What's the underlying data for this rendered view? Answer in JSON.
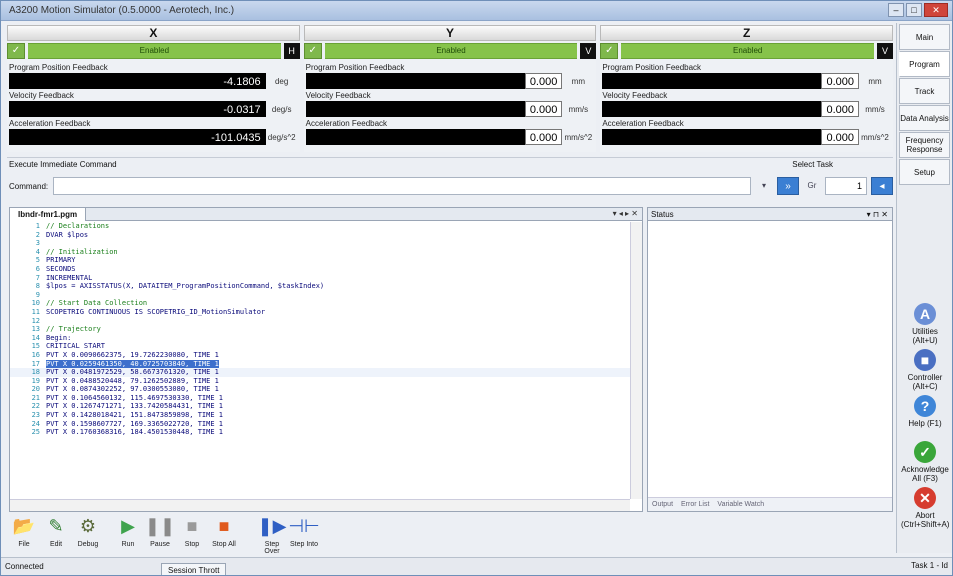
{
  "window": {
    "title": "A3200 Motion Simulator (0.5.0000 - Aerotech, Inc.)"
  },
  "axes": [
    {
      "name": "X",
      "state": "Enabled",
      "unit_btn": "H",
      "pos_label": "Program Position Feedback",
      "pos_val": "-4.1806",
      "pos_unit": "deg",
      "vel_label": "Velocity Feedback",
      "vel_val": "-0.0317",
      "vel_unit": "deg/s",
      "acc_label": "Acceleration Feedback",
      "acc_val": "-101.0435",
      "acc_unit": "deg/s^2"
    },
    {
      "name": "Y",
      "state": "Enabled",
      "unit_btn": "V",
      "pos_label": "Program Position Feedback",
      "pos_val": "0.000",
      "pos_unit": "mm",
      "vel_label": "Velocity Feedback",
      "vel_val": "0.000",
      "vel_unit": "mm/s",
      "acc_label": "Acceleration Feedback",
      "acc_val": "0.000",
      "acc_unit": "mm/s^2"
    },
    {
      "name": "Z",
      "state": "Enabled",
      "unit_btn": "V",
      "pos_label": "Program Position Feedback",
      "pos_val": "0.000",
      "pos_unit": "mm",
      "vel_label": "Velocity Feedback",
      "vel_val": "0.000",
      "vel_unit": "mm/s",
      "acc_label": "Acceleration Feedback",
      "acc_val": "0.000",
      "acc_unit": "mm/s^2"
    }
  ],
  "side_tabs": [
    "Main",
    "Program",
    "Track",
    "Data Analysis",
    "Frequency Response",
    "Setup"
  ],
  "side_icons": [
    {
      "label": "Utilities (Alt+U)",
      "glyph": "A"
    },
    {
      "label": "Controller (Alt+C)",
      "glyph": "■"
    },
    {
      "label": "Help (F1)",
      "glyph": "?"
    },
    {
      "label": "Acknowledge All (F3)",
      "glyph": "✓"
    },
    {
      "label": "Abort (Ctrl+Shift+A)",
      "glyph": "✕"
    }
  ],
  "command": {
    "panel_label": "Execute Immediate Command",
    "caption": "Command:",
    "value": "",
    "run": "»",
    "task_label": "Select Task",
    "task_value": "1",
    "task_prev": "Gr"
  },
  "editor": {
    "tab": "Ibndr-fmr1.pgm",
    "controls": "▾ ◂ ▸ ✕",
    "lines": [
      {
        "n": "1",
        "t": "// Declarations",
        "c": true
      },
      {
        "n": "2",
        "t": "DVAR $lpos",
        "c": false
      },
      {
        "n": "3",
        "t": "",
        "c": false
      },
      {
        "n": "4",
        "t": "// Initialization",
        "c": true
      },
      {
        "n": "5",
        "t": "PRIMARY",
        "c": false
      },
      {
        "n": "6",
        "t": "SECONDS",
        "c": false
      },
      {
        "n": "7",
        "t": "INCREMENTAL",
        "c": false
      },
      {
        "n": "8",
        "t": "$lpos = AXISSTATUS(X, DATAITEM_ProgramPositionCommand, $taskIndex)",
        "c": false
      },
      {
        "n": "9",
        "t": "",
        "c": false
      },
      {
        "n": "10",
        "t": "// Start Data Collection",
        "c": true
      },
      {
        "n": "11",
        "t": "SCOPETRIG CONTINUOUS IS SCOPETRIG_ID_MotionSimulator",
        "c": false
      },
      {
        "n": "12",
        "t": "",
        "c": false
      },
      {
        "n": "13",
        "t": "// Trajectory",
        "c": true
      },
      {
        "n": "14",
        "t": "Begin:",
        "c": false
      },
      {
        "n": "15",
        "t": "CRITICAL START",
        "c": false
      },
      {
        "n": "16",
        "t": "PVT X 0.0090662375, 19.7262230080, TIME 1",
        "c": false
      },
      {
        "n": "17",
        "t": "PVT X 0.0259461350, 40.0725703840, TIME 1",
        "c": false,
        "sel": true
      },
      {
        "n": "18",
        "t": "PVT X 0.0481972529, 58.6673761320, TIME 1",
        "c": false,
        "cur": true
      },
      {
        "n": "19",
        "t": "PVT X 0.0488520448, 79.1262502889, TIME 1",
        "c": false
      },
      {
        "n": "20",
        "t": "PVT X 0.0874302252, 97.0300553080, TIME 1",
        "c": false
      },
      {
        "n": "21",
        "t": "PVT X 0.1064560132, 115.4697530330, TIME 1",
        "c": false
      },
      {
        "n": "22",
        "t": "PVT X 0.1267471271, 133.7420584431, TIME 1",
        "c": false
      },
      {
        "n": "23",
        "t": "PVT X 0.1428018421, 151.8473859898, TIME 1",
        "c": false
      },
      {
        "n": "24",
        "t": "PVT X 0.1598607727, 169.3365022720, TIME 1",
        "c": false
      },
      {
        "n": "25",
        "t": "PVT X 0.1760368316, 184.4501530448, TIME 1",
        "c": false
      }
    ]
  },
  "status_panel": {
    "title": "Status",
    "controls": "▾ ⊓ ✕",
    "tabs": [
      "Output",
      "Error List",
      "Variable Watch"
    ]
  },
  "toolbar": [
    {
      "label": "File",
      "glyph": "📂",
      "color": "#d9a21b"
    },
    {
      "label": "Edit",
      "glyph": "✎",
      "color": "#2f7d2f"
    },
    {
      "label": "Debug",
      "glyph": "⚙",
      "color": "#5a6a3a"
    },
    {
      "label": "Run",
      "glyph": "▶",
      "color": "#3fa34d"
    },
    {
      "label": "Pause",
      "glyph": "❚❚",
      "color": "#8a8a8a"
    },
    {
      "label": "Stop",
      "glyph": "■",
      "color": "#9a9a9a"
    },
    {
      "label": "Stop All",
      "glyph": "■",
      "color": "#e05a1e"
    },
    {
      "label": "Step Over",
      "glyph": "❚▶",
      "color": "#2f5fc4"
    },
    {
      "label": "Step Into",
      "glyph": "⊣⊢",
      "color": "#2f5fc4"
    }
  ],
  "statusbar": {
    "left": "Connected",
    "tab": "Session Thrott",
    "right": "Task 1 - Id"
  }
}
